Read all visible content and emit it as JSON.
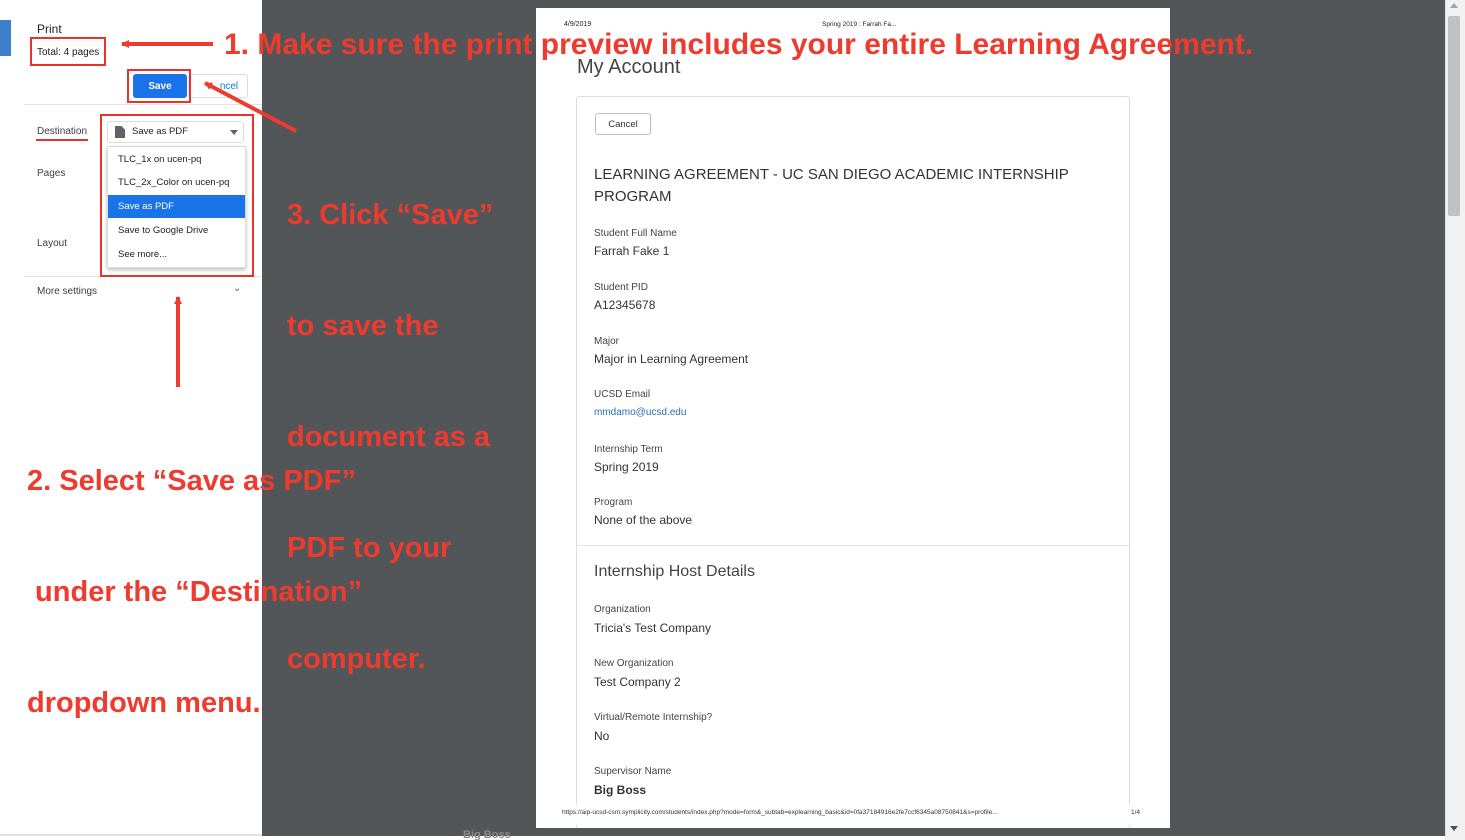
{
  "sidebar": {
    "title": "Print",
    "total": "Total: 4 pages",
    "save_label": "Save",
    "cancel_label": "Cancel",
    "cancel_visible": "ncel",
    "destination_label": "Destination",
    "pages_label": "Pages",
    "layout_label": "Layout",
    "more_settings_label": "More settings",
    "destination_value": "Save as PDF",
    "destination_options": [
      {
        "label": "TLC_1x on ucen-pq"
      },
      {
        "label": "TLC_2x_Color on ucen-pq"
      },
      {
        "label": "Save as PDF"
      },
      {
        "label": "Save to Google Drive"
      },
      {
        "label": "See more..."
      }
    ],
    "selected_option": "Save as PDF"
  },
  "preview": {
    "date": "4/9/2019",
    "header_title": "Spring 2019 : Farrah Fa...",
    "page_title": "My Account",
    "cancel_label": "Cancel",
    "heading": "LEARNING AGREEMENT - UC SAN DIEGO ACADEMIC INTERNSHIP PROGRAM",
    "fields": [
      {
        "label": "Student Full Name",
        "value": "Farrah Fake 1"
      },
      {
        "label": "Student PID",
        "value": "A12345678"
      },
      {
        "label": "Major",
        "value": "Major in Learning Agreement"
      },
      {
        "label": "UCSD Email",
        "value": "mmdamo@ucsd.edu"
      },
      {
        "label": "Internship Term",
        "value": "Spring 2019"
      },
      {
        "label": "Program",
        "value": "None of the above"
      }
    ],
    "host_heading": "Internship Host Details",
    "host_fields": [
      {
        "label": "Organization",
        "value": "Tricia's Test Company"
      },
      {
        "label": "New Organization",
        "value": "Test Company 2"
      },
      {
        "label": "Virtual/Remote Internship?",
        "value": "No"
      },
      {
        "label": "Supervisor Name",
        "value": "Big Boss"
      }
    ],
    "footer_url": "https://aip-ucsd-csm.symplicity.com/students/index.php?mode=form&_subtab=explearning_basic&id=0fa37184916e2fe7ccf6345a08750841&s=profile...",
    "footer_page": "1/4",
    "below_page_text": "Big Boss"
  },
  "annotations": {
    "step1": "1. Make sure the print preview includes your entire Learning Agreement.",
    "step2_lines": [
      "2. Select “Save as PDF”",
      " under the “Destination”",
      "dropdown menu."
    ],
    "step3_lines": [
      "3. Click “Save”",
      "to save the",
      "document as a",
      "PDF to your",
      "computer."
    ]
  },
  "colors": {
    "annotation_red": "#ee3b2f",
    "highlight_red": "#e8332a",
    "accent_blue": "#1a73e8",
    "preview_background": "#525659"
  }
}
